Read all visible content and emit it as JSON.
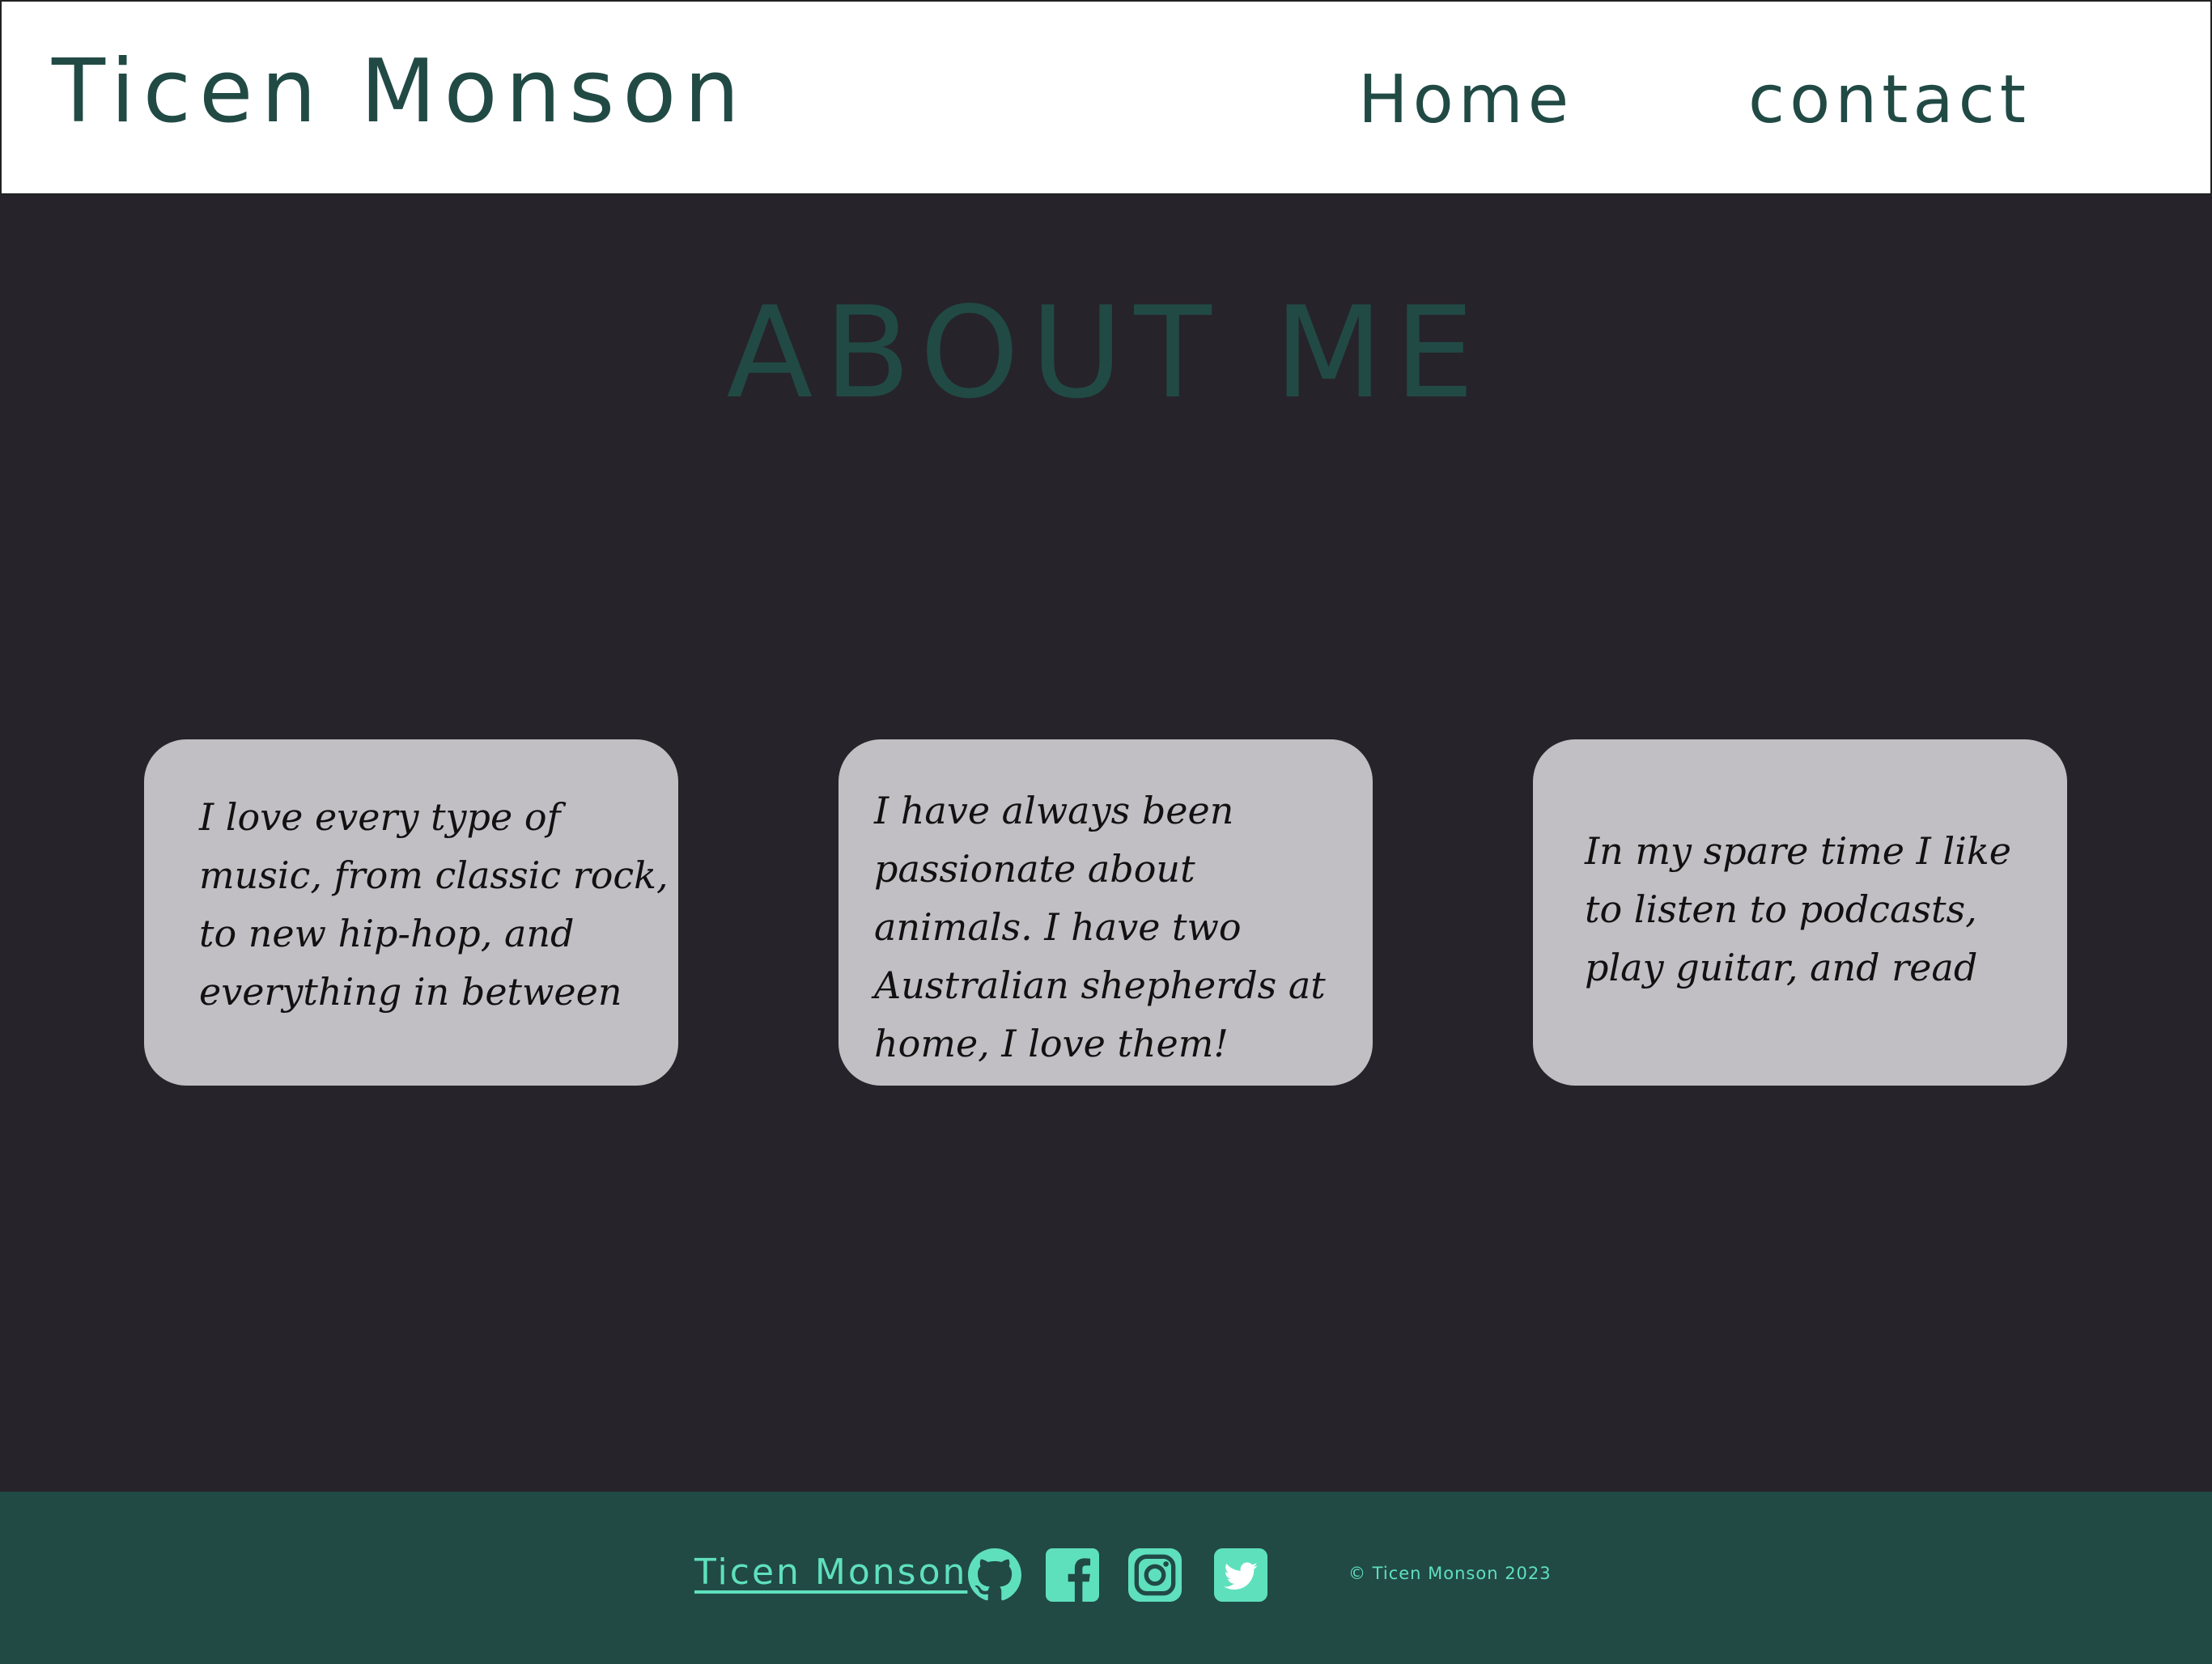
{
  "header": {
    "site_title": "Ticen Monson",
    "nav": {
      "home": "Home",
      "contact": "contact"
    }
  },
  "main": {
    "heading": "ABOUT ME",
    "cards": [
      {
        "text": "I love every type of music, from classic rock, to new hip-hop, and everything in between"
      },
      {
        "text": "I have always been passionate about animals. I have two Australian shepherds at home, I love them!"
      },
      {
        "text": "In my spare time I like to listen to podcasts, play guitar, and read"
      }
    ]
  },
  "footer": {
    "name_link": "Ticen Monson",
    "social_icons": [
      "github-icon",
      "facebook-icon",
      "instagram-icon",
      "twitter-icon"
    ],
    "copyright": "© Ticen Monson 2023"
  },
  "colors": {
    "header_bg": "#ffffff",
    "brand_green": "#214a45",
    "page_bg": "#27232a",
    "card_bg": "#c1bfc3",
    "accent_mint": "#5fe0bd"
  }
}
